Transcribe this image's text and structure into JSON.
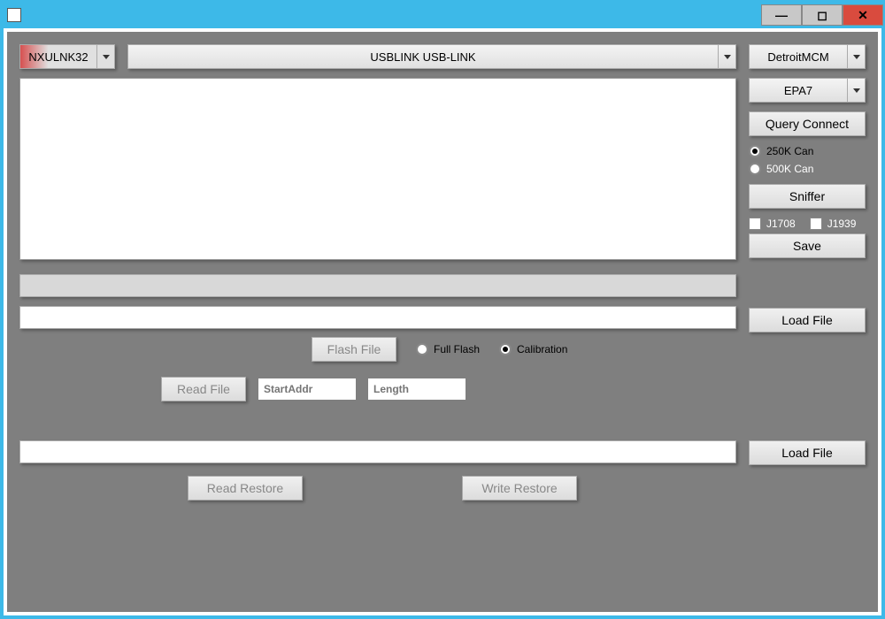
{
  "titlebar": {
    "title": ""
  },
  "dropdowns": {
    "adapter": "NXULNK32",
    "device": "USBLINK USB-LINK",
    "module": "DetroitMCM",
    "epa": "EPA7"
  },
  "buttons": {
    "queryConnect": "Query Connect",
    "sniffer": "Sniffer",
    "save": "Save",
    "loadFile1": "Load File",
    "loadFile2": "Load File",
    "flashFile": "Flash File",
    "readFile": "Read File",
    "readRestore": "Read Restore",
    "writeRestore": "Write Restore"
  },
  "radios": {
    "can250": "250K Can",
    "can500": "500K Can",
    "canSelected": "250K",
    "fullFlash": "Full Flash",
    "calibration": "Calibration",
    "flashModeSelected": "Calibration"
  },
  "checks": {
    "j1708": "J1708",
    "j1939": "J1939"
  },
  "inputs": {
    "startAddr": {
      "placeholder": "StartAddr",
      "value": ""
    },
    "length": {
      "placeholder": "Length",
      "value": ""
    }
  }
}
